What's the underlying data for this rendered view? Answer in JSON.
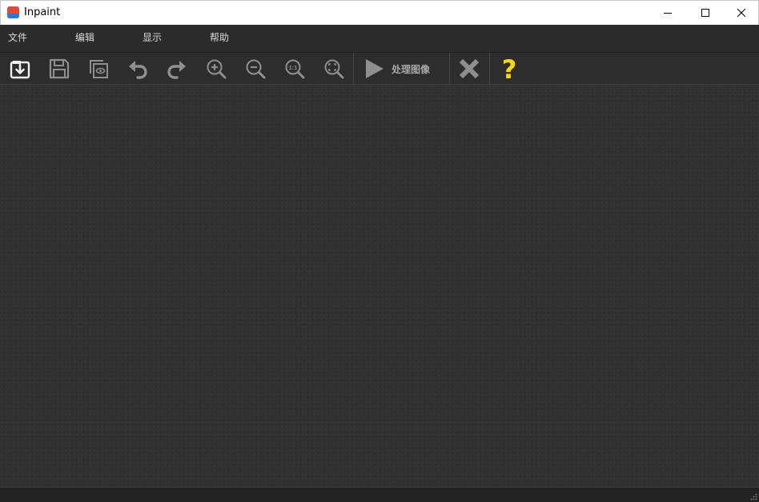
{
  "window": {
    "title": "Inpaint",
    "controls": {
      "minimize": "minimize-icon",
      "maximize": "maximize-icon",
      "close": "close-icon"
    }
  },
  "menu": {
    "items": [
      {
        "label": "文件"
      },
      {
        "label": "编辑"
      },
      {
        "label": "显示"
      },
      {
        "label": "帮助"
      }
    ]
  },
  "toolbar": {
    "icons": [
      "open-image-icon",
      "save-icon",
      "save-copy-preview-icon",
      "undo-icon",
      "redo-icon",
      "zoom-in-icon",
      "zoom-out-icon",
      "actual-size-icon",
      "fit-to-window-icon",
      "play-icon",
      "cancel-x-icon",
      "help-question-icon"
    ],
    "process_label": "处理图像",
    "help_glyph": "?",
    "actual_size_glyph": "1:1"
  },
  "colors": {
    "background": "#2b2b2b",
    "canvas": "#313131",
    "icon_gray": "#b4b4b4",
    "help_yellow": "#ffd800",
    "app_icon_red": "#e04a3a",
    "app_icon_blue": "#3a6fd8"
  }
}
